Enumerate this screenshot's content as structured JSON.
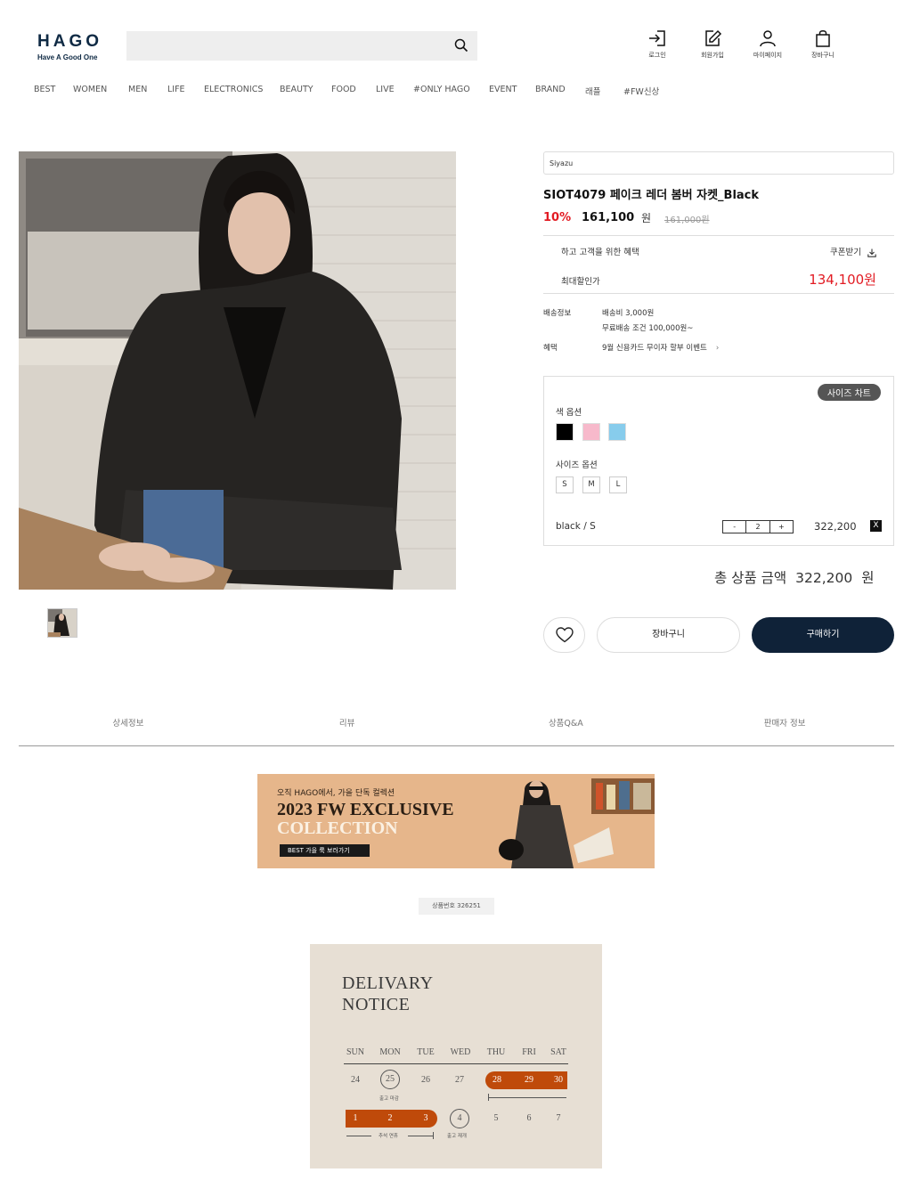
{
  "header": {
    "logo": "HAGO",
    "logo_tagline": "Have A Good One",
    "utility": [
      {
        "label": "로그인",
        "icon": "login-icon"
      },
      {
        "label": "회원가입",
        "icon": "signup-icon"
      },
      {
        "label": "마이페이지",
        "icon": "user-icon"
      },
      {
        "label": "장바구니",
        "icon": "bag-icon"
      }
    ]
  },
  "nav": [
    "BEST",
    "WOMEN",
    "MEN",
    "LIFE",
    "ELECTRONICS",
    "BEAUTY",
    "FOOD",
    "LIVE",
    "#ONLY HAGO",
    "EVENT",
    "BRAND",
    "래플",
    "#FW신상"
  ],
  "product": {
    "brand": "Siyazu",
    "name": "SIOT4079 페이크 레더 봄버 자켓_Black",
    "discount": "10%",
    "price": "161,100",
    "currency": "원",
    "original_price": "161,000원"
  },
  "benefit": {
    "title": "하고 고객을 위한 혜택",
    "coupon_label": "쿠폰받기",
    "max_label": "최대할인가",
    "max_price": "134,100원"
  },
  "shipping": {
    "label": "배송정보",
    "fee": "배송비 3,000원",
    "free": "무료배송 조건 100,000원~",
    "benefit_label": "혜택",
    "benefit_text": "9월 신용카드 무이자 할부 이벤트",
    "chevron": "›"
  },
  "options": {
    "size_chart": "사이즈 차트",
    "color_label": "색 옵션",
    "colors": [
      "#000000",
      "#f7b9cb",
      "#87ccec"
    ],
    "size_label": "사이즈 옵션",
    "sizes": [
      "S",
      "M",
      "L"
    ],
    "selected": {
      "name": "black / S",
      "minus": "-",
      "qty": "2",
      "plus": "+",
      "price": "322,200",
      "remove": "X"
    }
  },
  "total": {
    "label": "총 상품 금액",
    "amount": "322,200",
    "unit": "원"
  },
  "actions": {
    "cart": "장바구니",
    "buy": "구매하기"
  },
  "tabs": [
    "상세정보",
    "리뷰",
    "상품Q&A",
    "판매자 정보"
  ],
  "banner": {
    "subtitle": "오직 HAGO에서, 가을 단독 컬렉션",
    "line1": "2023 FW EXCLUSIVE",
    "line2": "COLLECTION",
    "cta": "BEST 가을 룩 보러가기"
  },
  "product_code": "상품번호 326251",
  "delivery": {
    "title1": "DELIVARY",
    "title2": "NOTICE",
    "days": [
      "SUN",
      "MON",
      "TUE",
      "WED",
      "THU",
      "FRI",
      "SAT"
    ],
    "week1": [
      "24",
      "25",
      "26",
      "27",
      "28",
      "29",
      "30"
    ],
    "week2": [
      "1",
      "2",
      "3",
      "4",
      "5",
      "6",
      "7"
    ],
    "note_deadline": "출고 마감",
    "note_holiday": "추석 연휴",
    "note_resume": "출고 재개"
  }
}
